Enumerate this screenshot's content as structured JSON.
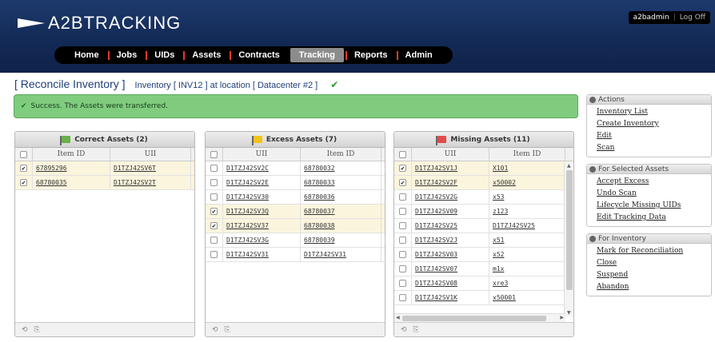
{
  "app": {
    "logo": "A2BTRACKING",
    "user": "a2badmin",
    "logoff": "Log Off"
  },
  "nav": {
    "items": [
      {
        "label": "Home"
      },
      {
        "label": "Jobs"
      },
      {
        "label": "UIDs"
      },
      {
        "label": "Assets"
      },
      {
        "label": "Contracts"
      },
      {
        "label": "Tracking",
        "active": true
      },
      {
        "label": "Reports"
      },
      {
        "label": "Admin"
      }
    ]
  },
  "page": {
    "title": "[ Reconcile Inventory ]",
    "subtitle": "Inventory [ INV12 ] at location [ Datacenter #2 ]",
    "check": "✔",
    "success": "Success. The Assets were transferred."
  },
  "panels": {
    "correct": {
      "title": "Correct Assets (2)",
      "flag_color": "#6ab04c",
      "col1": "Item ID",
      "col2": "UII",
      "rows": [
        {
          "checked": true,
          "c1": "67895296",
          "c2": "D1TZJ42SV6T"
        },
        {
          "checked": true,
          "c1": "68780035",
          "c2": "D1TZJ42SV2T"
        }
      ]
    },
    "excess": {
      "title": "Excess Assets (7)",
      "flag_color": "#f0c419",
      "col1": "UII",
      "col2": "Item ID",
      "rows": [
        {
          "checked": false,
          "c1": "D1TZJ42SV2C",
          "c2": "68780032"
        },
        {
          "checked": false,
          "c1": "D1TZJ42SV2E",
          "c2": "68780033"
        },
        {
          "checked": false,
          "c1": "D1TZJ42SV30",
          "c2": "68780036"
        },
        {
          "checked": true,
          "c1": "D1TZJ42SV3Q",
          "c2": "68780037"
        },
        {
          "checked": true,
          "c1": "D1TZJ42SV37",
          "c2": "68780038"
        },
        {
          "checked": false,
          "c1": "D1TZJ42SV3G",
          "c2": "68780039"
        },
        {
          "checked": false,
          "c1": "D1TZJ42SV31",
          "c2": "D1TZJ42SV31"
        }
      ]
    },
    "missing": {
      "title": "Missing Assets (11)",
      "flag_color": "#e24b4b",
      "col1": "UII",
      "col2": "Item ID",
      "rows": [
        {
          "checked": true,
          "c1": "D1TZJ42SV1J",
          "c2": "X101"
        },
        {
          "checked": true,
          "c1": "D1TZJ42SV2F",
          "c2": "x50002"
        },
        {
          "checked": false,
          "c1": "D1TZJ42SV2G",
          "c2": "x53"
        },
        {
          "checked": false,
          "c1": "D1TZJ42SV09",
          "c2": "z123"
        },
        {
          "checked": false,
          "c1": "D1TZJ42SV25",
          "c2": "D1TZJ42SV25"
        },
        {
          "checked": false,
          "c1": "D1TZJ42SV2J",
          "c2": "x51"
        },
        {
          "checked": false,
          "c1": "D1TZJ42SV03",
          "c2": "x52"
        },
        {
          "checked": false,
          "c1": "D1TZJ42SV07",
          "c2": "m1x"
        },
        {
          "checked": false,
          "c1": "D1TZJ42SV08",
          "c2": "xre3"
        },
        {
          "checked": false,
          "c1": "D1TZJ42SV1K",
          "c2": "x50001"
        }
      ]
    }
  },
  "sidebar": {
    "actions": {
      "title": "Actions",
      "links": [
        "Inventory List",
        "Create Inventory",
        "Edit",
        "Scan"
      ]
    },
    "selected": {
      "title": "For Selected Assets",
      "links": [
        "Accept Excess",
        "Undo Scan",
        "Lifecycle Missing UIDs",
        "Edit Tracking Data"
      ]
    },
    "inventory": {
      "title": "For Inventory",
      "links": [
        "Mark for Reconciliation",
        "Close",
        "Suspend",
        "Abandon"
      ]
    }
  },
  "footer_icons": [
    "refresh-icon",
    "export-icon"
  ]
}
